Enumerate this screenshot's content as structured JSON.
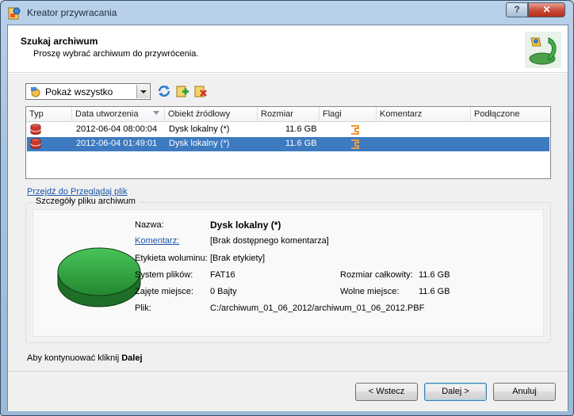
{
  "window": {
    "title": "Kreator przywracania"
  },
  "titlebar": {
    "help_label": "?",
    "close_label": "✕"
  },
  "header": {
    "title": "Szukaj archiwum",
    "subtitle": "Proszę wybrać archiwum do przywrócenia."
  },
  "filter": {
    "selected": "Pokaż wszystko"
  },
  "table": {
    "columns": [
      "Typ",
      "Data utworzenia",
      "Obiekt źródłowy",
      "Rozmiar",
      "Flagi",
      "Komentarz",
      "Podłączone"
    ],
    "rows": [
      {
        "date": "2012-06-04 08:00:04",
        "source": "Dysk lokalny (*)",
        "size": "11.6 GB",
        "selected": false
      },
      {
        "date": "2012-06-04 01:49:01",
        "source": "Dysk lokalny (*)",
        "size": "11.6 GB",
        "selected": true
      }
    ]
  },
  "browse_link": "Przejdź do Przeglądaj plik",
  "details": {
    "legend": "Szczegóły pliku archiwum",
    "name_label": "Nazwa:",
    "name_value": "Dysk lokalny (*)",
    "comment_label": "Komentarz:",
    "comment_value": "[Brak dostępnego komentarza]",
    "volume_label": "Etykieta woluminu:",
    "volume_value": "[Brak etykiety]",
    "fs_label": "System plików:",
    "fs_value": "FAT16",
    "total_label": "Rozmiar całkowity:",
    "total_value": "11.6 GB",
    "used_label": "Zajęte miejsce:",
    "used_value": "0 Bajty",
    "free_label": "Wolne miejsce:",
    "free_value": "11.6 GB",
    "file_label": "Plik:",
    "file_value": "C:/archiwum_01_06_2012/archiwum_01_06_2012.PBF"
  },
  "footer": {
    "hint_prefix": "Aby kontynuować kliknij ",
    "hint_bold": "Dalej"
  },
  "buttons": {
    "back": "< Wstecz",
    "next": "Dalej >",
    "cancel": "Anuluj"
  },
  "colors": {
    "selection": "#3d7ac0",
    "disk_green": "#2e9e3c",
    "link": "#1a55a6"
  }
}
